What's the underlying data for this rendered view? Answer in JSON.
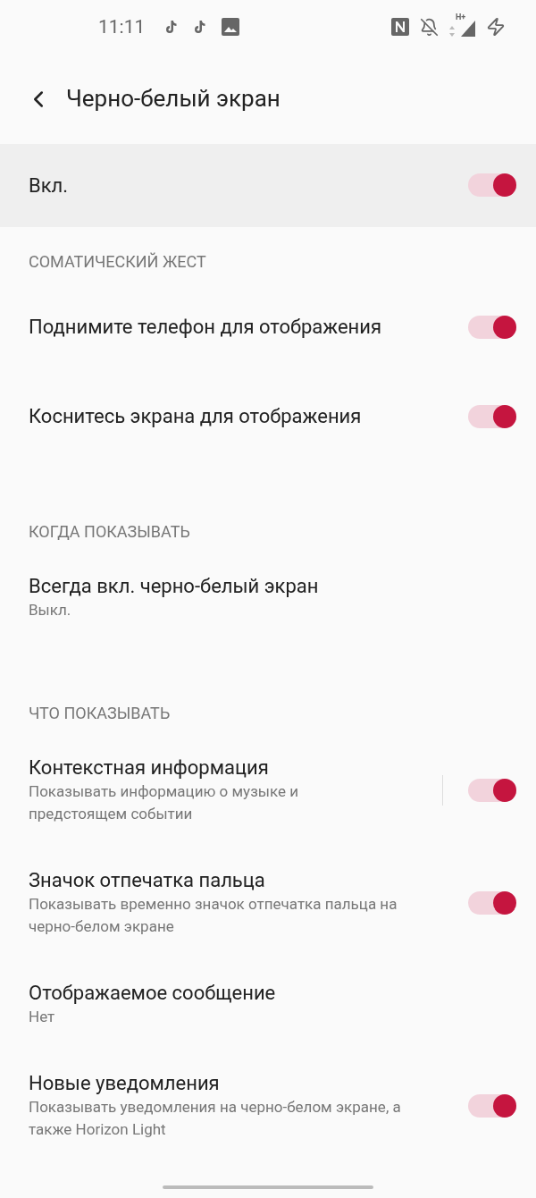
{
  "status_bar": {
    "time": "11:11",
    "network_type": "H+"
  },
  "header": {
    "title": "Черно-белый экран"
  },
  "main_switch": {
    "label": "Вкл.",
    "on": true
  },
  "sections": [
    {
      "title": "СОМАТИЧЕСКИЙ ЖЕСТ",
      "items": [
        {
          "kind": "toggle",
          "title": "Поднимите телефон для отображения",
          "on": true
        },
        {
          "kind": "toggle",
          "title": "Коснитесь экрана для отображения",
          "on": true
        }
      ]
    },
    {
      "title": "КОГДА ПОКАЗЫВАТЬ",
      "items": [
        {
          "kind": "value",
          "title": "Всегда вкл. черно-белый экран",
          "subtitle": "Выкл."
        }
      ]
    },
    {
      "title": "ЧТО ПОКАЗЫВАТЬ",
      "items": [
        {
          "kind": "toggle",
          "title": "Контекстная информация",
          "subtitle": "Показывать информацию о музыке и предстоящем событии",
          "on": true,
          "separated": true
        },
        {
          "kind": "toggle",
          "title": "Значок отпечатка пальца",
          "subtitle": "Показывать временно значок отпечатка пальца на черно-белом экране",
          "on": true
        },
        {
          "kind": "value",
          "title": "Отображаемое сообщение",
          "subtitle": "Нет"
        },
        {
          "kind": "toggle",
          "title": "Новые уведомления",
          "subtitle": "Показывать уведомления на черно-белом экране, а также Horizon Light",
          "on": true
        }
      ]
    }
  ]
}
